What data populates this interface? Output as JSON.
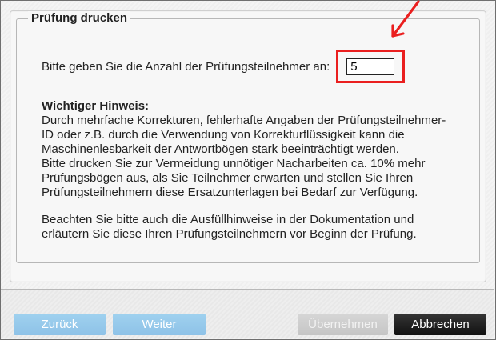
{
  "dialog": {
    "section_title": "Prüfung drucken",
    "prompt": "Bitte geben Sie die Anzahl der Prüfungsteilnehmer an:",
    "participant_count": "5"
  },
  "notice": {
    "title": "Wichtiger Hinweis:",
    "paragraph_1": "Durch mehrfache Korrekturen, fehlerhafte Angaben der Prüfungsteilnehmer-ID oder z.B. durch die Verwendung von Korrekturflüssigkeit kann die Maschinenlesbarkeit der Antwortbögen stark beeinträchtigt werden.",
    "paragraph_2": "Bitte drucken Sie zur Vermeidung unnötiger Nacharbeiten ca. 10% mehr Prüfungsbögen aus, als Sie Teilnehmer erwarten und stellen Sie Ihren Prüfungsteilnehmern diese Ersatzunterlagen bei Bedarf zur Verfügung.",
    "paragraph_3": "Beachten Sie bitte auch die Ausfüllhinweise in der Dokumentation und erläutern Sie diese Ihren Prüfungsteilnehmern vor Beginn der Prüfung."
  },
  "buttons": {
    "back": "Zurück",
    "next": "Weiter",
    "apply": "Übernehmen",
    "cancel": "Abbrechen"
  },
  "colors": {
    "highlight": "#ea1f1f",
    "primary_button": "#8ec2e7",
    "disabled_button": "#c5c5c5",
    "cancel_button": "#111111"
  },
  "icons": {
    "callout": "arrow-icon"
  }
}
